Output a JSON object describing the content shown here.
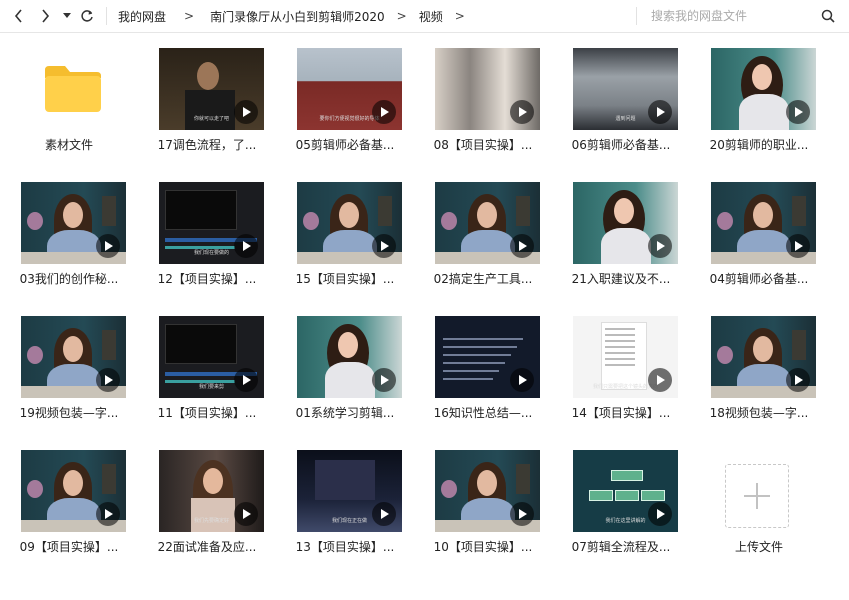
{
  "breadcrumb": {
    "items": [
      "我的网盘",
      "南门录像厅从小白到剪辑师2020",
      "视频"
    ],
    "separator": ">"
  },
  "search": {
    "placeholder": "搜索我的网盘文件"
  },
  "files": [
    {
      "type": "folder",
      "name": "素材文件"
    },
    {
      "type": "video",
      "name": "17调色流程，了...",
      "scene": "man",
      "caption": "你就可以走了吧"
    },
    {
      "type": "video",
      "name": "05剪辑师必备基...",
      "scene": "red",
      "caption": "要你们方便视觉很好的导体"
    },
    {
      "type": "video",
      "name": "08【项目实操】...",
      "scene": "blur",
      "caption": ""
    },
    {
      "type": "video",
      "name": "06剪辑师必备基...",
      "scene": "parking",
      "caption": "遇到问题"
    },
    {
      "type": "video",
      "name": "20剪辑师的职业...",
      "scene": "bright",
      "caption": ""
    },
    {
      "type": "video",
      "name": "03我们的创作秘...",
      "scene": "studio",
      "caption": ""
    },
    {
      "type": "video",
      "name": "12【项目实操】...",
      "scene": "editor",
      "caption": "我们现在要做的"
    },
    {
      "type": "video",
      "name": "15【项目实操】...",
      "scene": "studio",
      "caption": ""
    },
    {
      "type": "video",
      "name": "02搞定生产工具...",
      "scene": "studio",
      "caption": ""
    },
    {
      "type": "video",
      "name": "21入职建议及不...",
      "scene": "bright",
      "caption": ""
    },
    {
      "type": "video",
      "name": "04剪辑师必备基...",
      "scene": "studio",
      "caption": ""
    },
    {
      "type": "video",
      "name": "19视频包装—字...",
      "scene": "studio",
      "caption": ""
    },
    {
      "type": "video",
      "name": "11【项目实操】...",
      "scene": "editor",
      "caption": "我们要来剪"
    },
    {
      "type": "video",
      "name": "01系统学习剪辑...",
      "scene": "bright",
      "caption": ""
    },
    {
      "type": "video",
      "name": "16知识性总结—...",
      "scene": "text",
      "caption": ""
    },
    {
      "type": "video",
      "name": "14【项目实操】...",
      "scene": "doc",
      "caption": "我们只需要把这个镜头的方向"
    },
    {
      "type": "video",
      "name": "18视频包装—字...",
      "scene": "studio",
      "caption": ""
    },
    {
      "type": "video",
      "name": "09【项目实操】...",
      "scene": "studio",
      "caption": ""
    },
    {
      "type": "video",
      "name": "22面试准备及应...",
      "scene": "interview",
      "caption": "我们先要确定好"
    },
    {
      "type": "video",
      "name": "13【项目实操】...",
      "scene": "night",
      "caption": "我们现在正在做"
    },
    {
      "type": "video",
      "name": "10【项目实操】...",
      "scene": "studio",
      "caption": ""
    },
    {
      "type": "video",
      "name": "07剪辑全流程及...",
      "scene": "flow",
      "caption": "我们在这里讲解的"
    },
    {
      "type": "upload",
      "name": "上传文件"
    }
  ],
  "colors": {
    "folder": "#FFD04A",
    "folder_tab": "#F5BD2E",
    "accent": "#333333"
  }
}
